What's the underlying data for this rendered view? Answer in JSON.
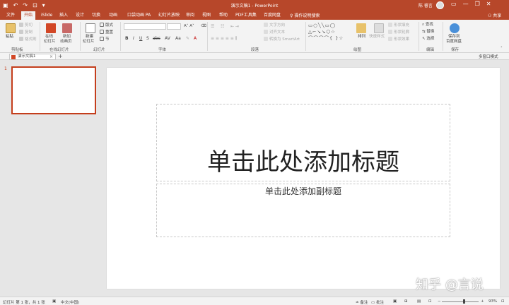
{
  "window": {
    "title": "演示文稿1 - PowerPoint",
    "user_name": "陈 睿言",
    "qat_icons": [
      "save-icon",
      "undo-icon",
      "redo-icon",
      "present-icon",
      "customize-icon"
    ],
    "qat_glyphs": [
      "▣",
      "↶",
      "↷",
      "⊡",
      "▾"
    ],
    "window_controls": [
      "▭",
      "—",
      "❐",
      "✕"
    ]
  },
  "tabs": {
    "items": [
      "文件",
      "开始",
      "iSlide",
      "插入",
      "设计",
      "切换",
      "动画",
      "口袋动画 PA",
      "幻灯片放映",
      "审阅",
      "视图",
      "帮助",
      "PDF工具集",
      "百度网盘"
    ],
    "active_index": 1,
    "search_label": "操作说明搜索",
    "share_label": "共享"
  },
  "ribbon": {
    "clipboard": {
      "label": "剪贴板",
      "paste": "粘贴",
      "cut": "剪切",
      "copy": "复制",
      "format_painter": "格式刷"
    },
    "online_slides": {
      "label": "在线幻灯片",
      "online": "在线",
      "online2": "幻灯片",
      "newslide": "新加",
      "newslide2": "动画页"
    },
    "slides": {
      "label": "幻灯片",
      "new": "新建",
      "new2": "幻灯片",
      "layout": "版式",
      "reset": "重置",
      "section": "节"
    },
    "font": {
      "label": "字体"
    },
    "paragraph": {
      "label": "段落",
      "text_direction": "文字方向",
      "align_text": "对齐文本",
      "smartart": "转换为 SmartArt"
    },
    "drawing": {
      "label": "绘图",
      "arrange": "排列",
      "quick_styles": "快速样式",
      "shape_fill": "形状填充",
      "shape_outline": "形状轮廓",
      "shape_effects": "形状效果"
    },
    "editing": {
      "label": "编辑",
      "find": "查找",
      "replace": "替换",
      "select": "选择"
    },
    "save": {
      "label": "保存",
      "baidu": "保存到",
      "baidu2": "百度网盘"
    }
  },
  "doc_tab": {
    "name": "演示文稿1",
    "multi_window": "多窗口模式"
  },
  "thumbnails": [
    {
      "number": "1"
    }
  ],
  "slide": {
    "title_placeholder": "单击此处添加标题",
    "subtitle_placeholder": "单击此处添加副标题"
  },
  "watermark": "知乎 @言说",
  "status": {
    "slide_info": "幻灯片 第 1 张，共 1 张",
    "language": "中文(中国)",
    "notes": "备注",
    "comments": "批注",
    "zoom": "93%"
  }
}
